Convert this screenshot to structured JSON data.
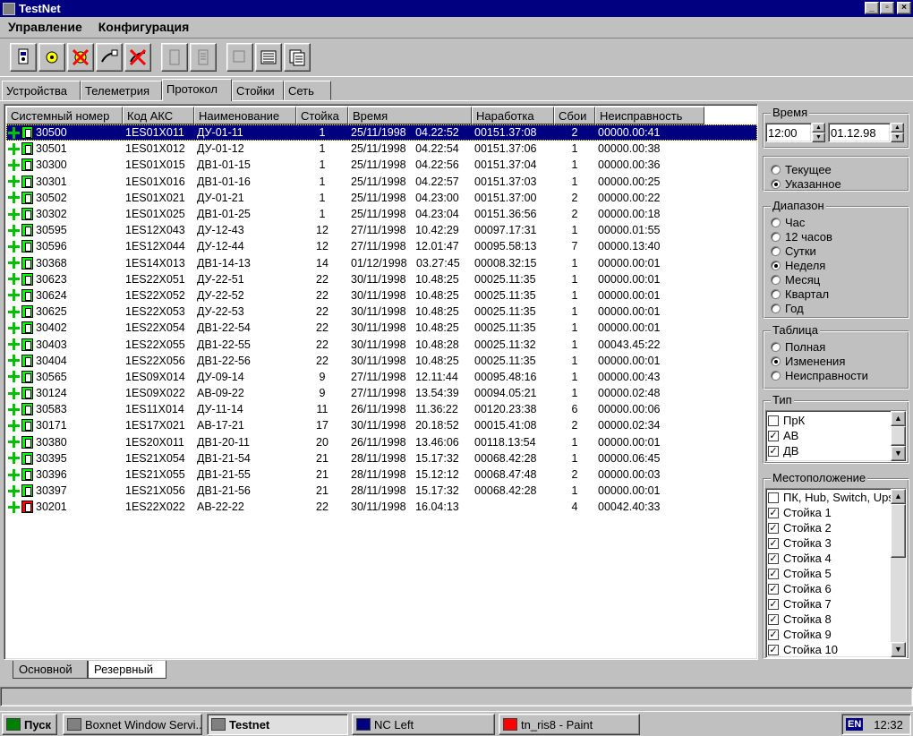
{
  "window": {
    "title": "TestNet"
  },
  "menu": [
    "Управление",
    "Конфигурация"
  ],
  "tabs": [
    "Устройства",
    "Телеметрия",
    "Протокол",
    "Стойки",
    "Сеть"
  ],
  "active_tab": "Протокол",
  "columns": [
    "Системный номер",
    "Код АКС",
    "Наименование",
    "Стойка",
    "Время",
    "Наработка",
    "Сбои",
    "Неисправность"
  ],
  "rows": [
    {
      "sys": "30500",
      "aks": "1ES01X011",
      "name": "ДУ-01-11",
      "rack": "1",
      "date": "25/11/1998",
      "time": "04.22:52",
      "runtime": "00151.37:08",
      "faults": "2",
      "malf": "00000.00:41",
      "selected": true
    },
    {
      "sys": "30501",
      "aks": "1ES01X012",
      "name": "ДУ-01-12",
      "rack": "1",
      "date": "25/11/1998",
      "time": "04.22:54",
      "runtime": "00151.37:06",
      "faults": "1",
      "malf": "00000.00:38"
    },
    {
      "sys": "30300",
      "aks": "1ES01X015",
      "name": "ДВ1-01-15",
      "rack": "1",
      "date": "25/11/1998",
      "time": "04.22:56",
      "runtime": "00151.37:04",
      "faults": "1",
      "malf": "00000.00:36"
    },
    {
      "sys": "30301",
      "aks": "1ES01X016",
      "name": "ДВ1-01-16",
      "rack": "1",
      "date": "25/11/1998",
      "time": "04.22:57",
      "runtime": "00151.37:03",
      "faults": "1",
      "malf": "00000.00:25"
    },
    {
      "sys": "30502",
      "aks": "1ES01X021",
      "name": "ДУ-01-21",
      "rack": "1",
      "date": "25/11/1998",
      "time": "04.23:00",
      "runtime": "00151.37:00",
      "faults": "2",
      "malf": "00000.00:22"
    },
    {
      "sys": "30302",
      "aks": "1ES01X025",
      "name": "ДВ1-01-25",
      "rack": "1",
      "date": "25/11/1998",
      "time": "04.23:04",
      "runtime": "00151.36:56",
      "faults": "2",
      "malf": "00000.00:18"
    },
    {
      "sys": "30595",
      "aks": "1ES12X043",
      "name": "ДУ-12-43",
      "rack": "12",
      "date": "27/11/1998",
      "time": "10.42:29",
      "runtime": "00097.17:31",
      "faults": "1",
      "malf": "00000.01:55"
    },
    {
      "sys": "30596",
      "aks": "1ES12X044",
      "name": "ДУ-12-44",
      "rack": "12",
      "date": "27/11/1998",
      "time": "12.01:47",
      "runtime": "00095.58:13",
      "faults": "7",
      "malf": "00000.13:40"
    },
    {
      "sys": "30368",
      "aks": "1ES14X013",
      "name": "ДВ1-14-13",
      "rack": "14",
      "date": "01/12/1998",
      "time": "03.27:45",
      "runtime": "00008.32:15",
      "faults": "1",
      "malf": "00000.00:01"
    },
    {
      "sys": "30623",
      "aks": "1ES22X051",
      "name": "ДУ-22-51",
      "rack": "22",
      "date": "30/11/1998",
      "time": "10.48:25",
      "runtime": "00025.11:35",
      "faults": "1",
      "malf": "00000.00:01"
    },
    {
      "sys": "30624",
      "aks": "1ES22X052",
      "name": "ДУ-22-52",
      "rack": "22",
      "date": "30/11/1998",
      "time": "10.48:25",
      "runtime": "00025.11:35",
      "faults": "1",
      "malf": "00000.00:01"
    },
    {
      "sys": "30625",
      "aks": "1ES22X053",
      "name": "ДУ-22-53",
      "rack": "22",
      "date": "30/11/1998",
      "time": "10.48:25",
      "runtime": "00025.11:35",
      "faults": "1",
      "malf": "00000.00:01"
    },
    {
      "sys": "30402",
      "aks": "1ES22X054",
      "name": "ДВ1-22-54",
      "rack": "22",
      "date": "30/11/1998",
      "time": "10.48:25",
      "runtime": "00025.11:35",
      "faults": "1",
      "malf": "00000.00:01"
    },
    {
      "sys": "30403",
      "aks": "1ES22X055",
      "name": "ДВ1-22-55",
      "rack": "22",
      "date": "30/11/1998",
      "time": "10.48:28",
      "runtime": "00025.11:32",
      "faults": "1",
      "malf": "00043.45:22"
    },
    {
      "sys": "30404",
      "aks": "1ES22X056",
      "name": "ДВ1-22-56",
      "rack": "22",
      "date": "30/11/1998",
      "time": "10.48:25",
      "runtime": "00025.11:35",
      "faults": "1",
      "malf": "00000.00:01"
    },
    {
      "sys": "30565",
      "aks": "1ES09X014",
      "name": "ДУ-09-14",
      "rack": "9",
      "date": "27/11/1998",
      "time": "12.11:44",
      "runtime": "00095.48:16",
      "faults": "1",
      "malf": "00000.00:43"
    },
    {
      "sys": "30124",
      "aks": "1ES09X022",
      "name": "АВ-09-22",
      "rack": "9",
      "date": "27/11/1998",
      "time": "13.54:39",
      "runtime": "00094.05:21",
      "faults": "1",
      "malf": "00000.02:48"
    },
    {
      "sys": "30583",
      "aks": "1ES11X014",
      "name": "ДУ-11-14",
      "rack": "11",
      "date": "26/11/1998",
      "time": "11.36:22",
      "runtime": "00120.23:38",
      "faults": "6",
      "malf": "00000.00:06"
    },
    {
      "sys": "30171",
      "aks": "1ES17X021",
      "name": "АВ-17-21",
      "rack": "17",
      "date": "30/11/1998",
      "time": "20.18:52",
      "runtime": "00015.41:08",
      "faults": "2",
      "malf": "00000.02:34"
    },
    {
      "sys": "30380",
      "aks": "1ES20X011",
      "name": "ДВ1-20-11",
      "rack": "20",
      "date": "26/11/1998",
      "time": "13.46:06",
      "runtime": "00118.13:54",
      "faults": "1",
      "malf": "00000.00:01"
    },
    {
      "sys": "30395",
      "aks": "1ES21X054",
      "name": "ДВ1-21-54",
      "rack": "21",
      "date": "28/11/1998",
      "time": "15.17:32",
      "runtime": "00068.42:28",
      "faults": "1",
      "malf": "00000.06:45"
    },
    {
      "sys": "30396",
      "aks": "1ES21X055",
      "name": "ДВ1-21-55",
      "rack": "21",
      "date": "28/11/1998",
      "time": "15.12:12",
      "runtime": "00068.47:48",
      "faults": "2",
      "malf": "00000.00:03"
    },
    {
      "sys": "30397",
      "aks": "1ES21X056",
      "name": "ДВ1-21-56",
      "rack": "21",
      "date": "28/11/1998",
      "time": "15.17:32",
      "runtime": "00068.42:28",
      "faults": "1",
      "malf": "00000.00:01"
    },
    {
      "sys": "30201",
      "aks": "1ES22X022",
      "name": "АВ-22-22",
      "rack": "22",
      "date": "30/11/1998",
      "time": "16.04:13",
      "runtime": "",
      "faults": "4",
      "malf": "00042.40:33",
      "error": true
    }
  ],
  "bottom_tabs": [
    "Основной",
    "Резервный"
  ],
  "panel": {
    "time_label": "Время",
    "time_value": "12:00",
    "date_value": "01.12.98",
    "mode_options": [
      {
        "label": "Текущее",
        "on": false
      },
      {
        "label": "Указанное",
        "on": true
      }
    ],
    "range_label": "Диапазон",
    "range_options": [
      {
        "label": "Час",
        "on": false
      },
      {
        "label": "12 часов",
        "on": false
      },
      {
        "label": "Сутки",
        "on": false
      },
      {
        "label": "Неделя",
        "on": true
      },
      {
        "label": "Месяц",
        "on": false
      },
      {
        "label": "Квартал",
        "on": false
      },
      {
        "label": "Год",
        "on": false
      }
    ],
    "table_label": "Таблица",
    "table_options": [
      {
        "label": "Полная",
        "on": false
      },
      {
        "label": "Изменения",
        "on": true
      },
      {
        "label": "Неисправности",
        "on": false
      }
    ],
    "type_label": "Тип",
    "type_items": [
      {
        "label": "ПрК",
        "checked": false
      },
      {
        "label": "АВ",
        "checked": true
      },
      {
        "label": "ДВ",
        "checked": true
      }
    ],
    "location_label": "Местоположение",
    "location_items": [
      {
        "label": "ПК, Hub, Switch, Ups",
        "checked": false
      },
      {
        "label": "Стойка 1",
        "checked": true
      },
      {
        "label": "Стойка 2",
        "checked": true
      },
      {
        "label": "Стойка 3",
        "checked": true
      },
      {
        "label": "Стойка 4",
        "checked": true
      },
      {
        "label": "Стойка 5",
        "checked": true
      },
      {
        "label": "Стойка 6",
        "checked": true
      },
      {
        "label": "Стойка 7",
        "checked": true
      },
      {
        "label": "Стойка 8",
        "checked": true
      },
      {
        "label": "Стойка 9",
        "checked": true
      },
      {
        "label": "Стойка 10",
        "checked": true
      }
    ]
  },
  "taskbar": {
    "start": "Пуск",
    "tasks": [
      "Boxnet Window Servi...",
      "Testnet",
      "NC Left",
      "tn_ris8 - Paint"
    ],
    "active_task": "Testnet",
    "lang": "EN",
    "clock": "12:32"
  }
}
